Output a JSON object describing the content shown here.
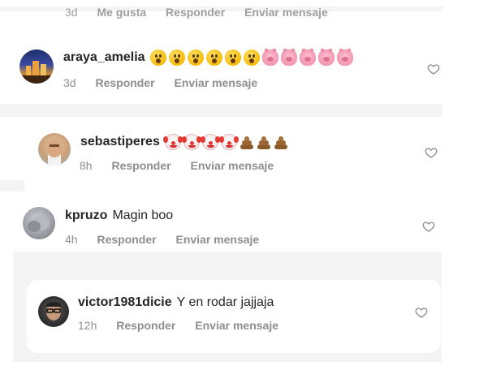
{
  "top_cut_row": {
    "time": "3d",
    "like": "Me gusta",
    "reply": "Responder",
    "send": "Enviar mensaje"
  },
  "comments": [
    {
      "username": "araya_amelia",
      "text": "",
      "emojis": [
        "hushed-face",
        "hushed-face",
        "hushed-face",
        "hushed-face",
        "hushed-face",
        "hushed-face",
        "pig-face",
        "pig-face",
        "pig-face",
        "pig-face",
        "pig-face"
      ],
      "time": "3d",
      "reply": "Responder",
      "send": "Enviar mensaje"
    },
    {
      "username": "sebastiperes",
      "text": "",
      "emojis": [
        "clown-face",
        "clown-face",
        "clown-face",
        "clown-face",
        "pile-of-poo",
        "pile-of-poo",
        "pile-of-poo"
      ],
      "time": "8h",
      "reply": "Responder",
      "send": "Enviar mensaje"
    },
    {
      "username": "kpruzo",
      "text": "Magin boo",
      "emojis": [],
      "time": "4h",
      "reply": "Responder",
      "send": "Enviar mensaje"
    },
    {
      "username": "victor1981dicie",
      "text": "Y en rodar jajjaja",
      "emojis": [],
      "time": "12h",
      "reply": "Responder",
      "send": "Enviar mensaje"
    }
  ],
  "icons": {
    "like": "heart-outline-icon"
  },
  "colors": {
    "text": "#262626",
    "muted": "#8e8e8e",
    "strip": "#f4f4f4"
  }
}
